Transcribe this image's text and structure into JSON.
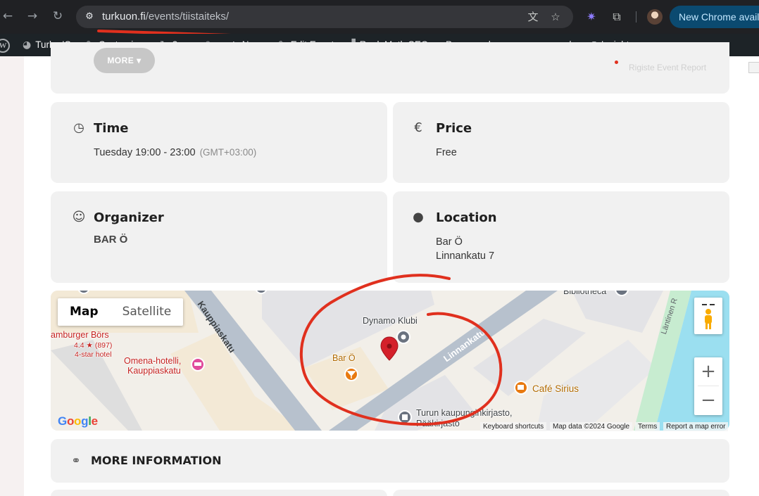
{
  "browser": {
    "url_host": "turkuon.fi",
    "url_path": "/events/tiistaiteks/",
    "update_button": "New Chrome availa"
  },
  "adminbar": {
    "site": "Turku IS",
    "customize": "Customize",
    "updates_count": "3",
    "comments_count": "0",
    "new": "New",
    "edit_event": "Edit Event",
    "rank_math": "Rank Math SEO",
    "purge_cache": "Purge cache",
    "insights": "Insights"
  },
  "event": {
    "more_button": "MORE",
    "time": {
      "title": "Time",
      "value": "Tuesday 19:00 - 23:00",
      "timezone": "(GMT+03:00)"
    },
    "price": {
      "title": "Price",
      "value": "Free"
    },
    "organizer": {
      "title": "Organizer",
      "value": "BAR Ö"
    },
    "location": {
      "title": "Location",
      "name": "Bar Ö",
      "address": "Linnankatu 7"
    },
    "more_information": "MORE INFORMATION"
  },
  "map": {
    "toggle_map": "Map",
    "toggle_satellite": "Satellite",
    "labels": {
      "kauppiaskatu": "Kauppiaskatu",
      "linnankatu": "Linnankatu",
      "lantinen": "Läntinen R",
      "dynamo": "Dynamo Klubi",
      "bar": "Bar Ö",
      "hamburger": "amburger Börs",
      "hamburger_rating": "4.4 ★ (897)",
      "hamburger_type": "4-star hotel",
      "omena_1": "Omena-hotelli,",
      "omena_2": "Kauppiaskatu",
      "cafe": "Café Sirius",
      "library_1": "Turun kaupunginkirjasto,",
      "library_2": "Pääkirjasto",
      "bibliotheca": "Bibliotheca"
    },
    "google_logo": "Google",
    "attribution": {
      "shortcuts": "Keyboard shortcuts",
      "data": "Map data ©2024 Google",
      "terms": "Terms",
      "report": "Report a map error"
    }
  },
  "colors": {
    "annotation_red": "#e0301e",
    "card_bg": "#f1f1f1",
    "chrome_bg": "#202124",
    "adminbar_bg": "#1d2327"
  }
}
